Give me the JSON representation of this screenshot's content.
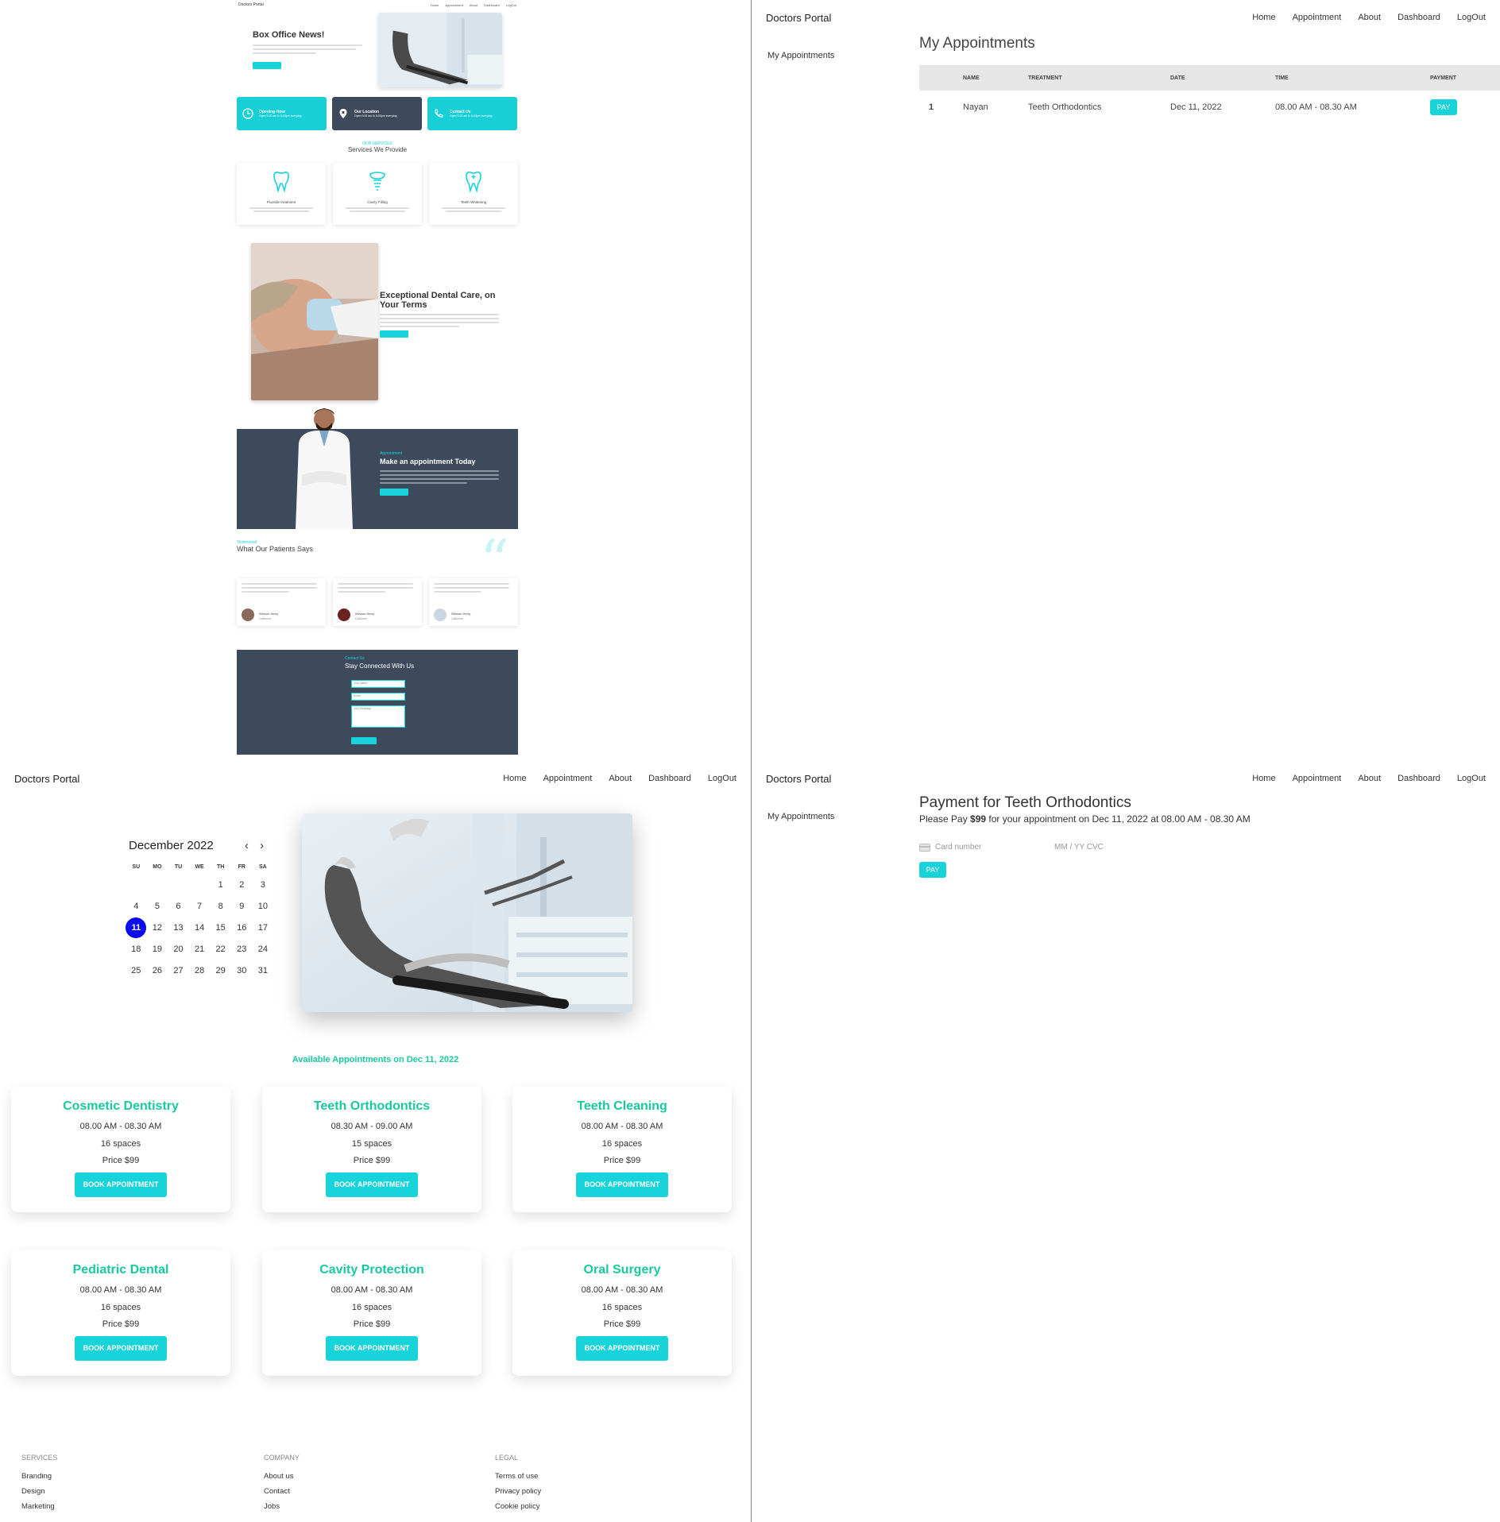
{
  "landing": {
    "brand": "Doctors Portal",
    "nav": [
      "Home",
      "Appointment",
      "About",
      "Dashboard",
      "LogOut"
    ],
    "hero_title": "Box Office News!",
    "info_cards": [
      {
        "title": "Opening Hour",
        "sub": "Open 9:00 am to 5:00pm everyday"
      },
      {
        "title": "Our Location",
        "sub": "Open 9:00 am to 5:00pm everyday"
      },
      {
        "title": "Contact Us",
        "sub": "Open 9:00 am to 5:00pm everyday"
      }
    ],
    "services_kicker": "OUR SERVICES",
    "services_title": "Services We Provide",
    "services": [
      "Fluoride treatment",
      "Cavity Filling",
      "Teeth Whitening"
    ],
    "care_title": "Exceptional Dental Care, on Your Terms",
    "appointment_kicker": "Appointment",
    "appointment_title": "Make an appointment Today",
    "testimonial_kicker": "Testimonial",
    "testimonial_title": "What Our Patients Says",
    "testimonials": [
      {
        "name": "Winson Herry",
        "role": "California"
      },
      {
        "name": "Winson Herry",
        "role": "California"
      },
      {
        "name": "Winson Herry",
        "role": "California"
      }
    ],
    "contact_kicker": "Contact Us",
    "contact_title": "Stay Connected With Us",
    "contact_inputs": [
      "Your Name",
      "Email",
      "Your Message"
    ],
    "colors": {
      "teal": "#19d3da",
      "dark_panel": "#3d4a5c"
    }
  },
  "dashboard": {
    "brand": "Doctors Portal",
    "nav": [
      "Home",
      "Appointment",
      "About",
      "Dashboard",
      "LogOut"
    ],
    "sidebar_item": "My Appointments",
    "title": "My Appointments",
    "columns": [
      "",
      "NAME",
      "TREATMENT",
      "DATE",
      "TIME",
      "PAYMENT"
    ],
    "rows": [
      {
        "num": "1",
        "name": "Nayan",
        "treatment": "Teeth Orthodontics",
        "date": "Dec 11, 2022",
        "time": "08.00 AM - 08.30 AM",
        "pay": "PAY"
      }
    ]
  },
  "appointment": {
    "brand": "Doctors Portal",
    "nav": [
      "Home",
      "Appointment",
      "About",
      "Dashboard",
      "LogOut"
    ],
    "calendar": {
      "month": "December 2022",
      "weekdays": [
        "SU",
        "MO",
        "TU",
        "WE",
        "TH",
        "FR",
        "SA"
      ],
      "first_weekday": 4,
      "days_in_month": 31,
      "selected_day": 11,
      "prev_icon": "chevron-left-icon",
      "next_icon": "chevron-right-icon"
    },
    "available_text": "Available Appointments on Dec 11, 2022",
    "services": [
      {
        "name": "Cosmetic Dentistry",
        "time": "08.00 AM - 08.30 AM",
        "spaces": "16 spaces",
        "price": "Price $99",
        "button": "BOOK APPOINTMENT"
      },
      {
        "name": "Teeth Orthodontics",
        "time": "08.30 AM - 09.00 AM",
        "spaces": "15 spaces",
        "price": "Price $99",
        "button": "BOOK APPOINTMENT"
      },
      {
        "name": "Teeth Cleaning",
        "time": "08.00 AM - 08.30 AM",
        "spaces": "16 spaces",
        "price": "Price $99",
        "button": "BOOK APPOINTMENT"
      },
      {
        "name": "Pediatric Dental",
        "time": "08.00 AM - 08.30 AM",
        "spaces": "16 spaces",
        "price": "Price $99",
        "button": "BOOK APPOINTMENT"
      },
      {
        "name": "Cavity Protection",
        "time": "08.00 AM - 08.30 AM",
        "spaces": "16 spaces",
        "price": "Price $99",
        "button": "BOOK APPOINTMENT"
      },
      {
        "name": "Oral Surgery",
        "time": "08.00 AM - 08.30 AM",
        "spaces": "16 spaces",
        "price": "Price $99",
        "button": "BOOK APPOINTMENT"
      }
    ],
    "footer": [
      {
        "heading": "SERVICES",
        "items": [
          "Branding",
          "Design",
          "Marketing"
        ]
      },
      {
        "heading": "COMPANY",
        "items": [
          "About us",
          "Contact",
          "Jobs"
        ]
      },
      {
        "heading": "LEGAL",
        "items": [
          "Terms of use",
          "Privacy policy",
          "Cookie policy"
        ]
      }
    ],
    "colors": {
      "accent_green": "#19c99e",
      "selected_day": "#0a0aee"
    }
  },
  "payment": {
    "brand": "Doctors Portal",
    "nav": [
      "Home",
      "Appointment",
      "About",
      "Dashboard",
      "LogOut"
    ],
    "sidebar_item": "My Appointments",
    "title": "Payment for Teeth Orthodontics",
    "sub_prefix": "Please Pay ",
    "sub_amount": "$99",
    "sub_suffix": " for your appointment on Dec 11, 2022 at 08.00 AM - 08.30 AM",
    "card_placeholder": "Card number",
    "expiry_placeholder": "MM / YY  CVC",
    "card_icon": "credit-card-icon",
    "pay_button": "PAY"
  }
}
